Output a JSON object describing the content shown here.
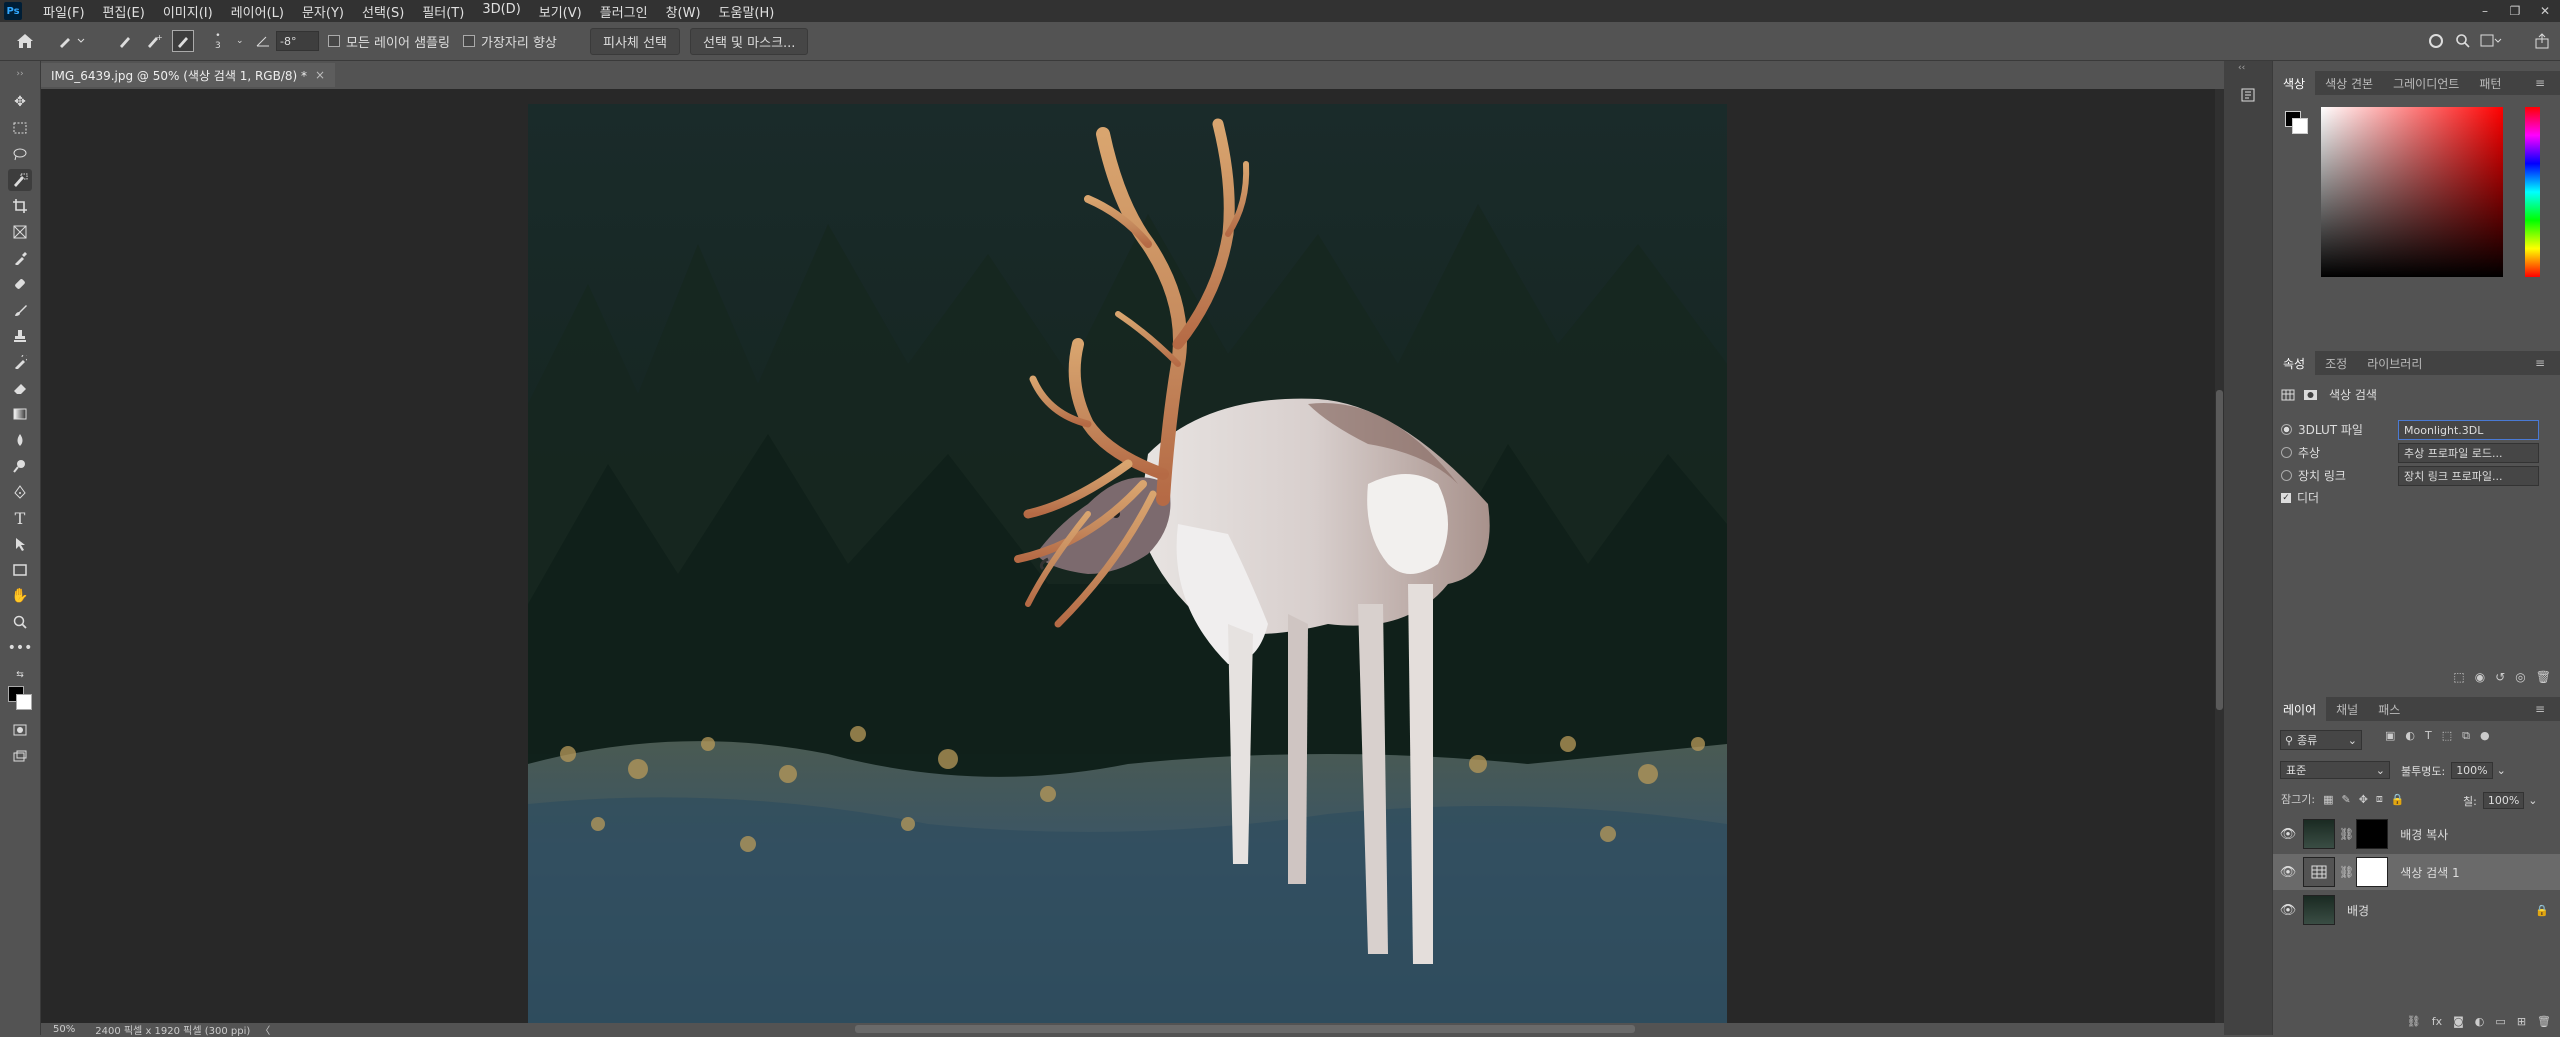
{
  "app": {
    "logo": "Ps"
  },
  "menu": [
    "파일(F)",
    "편집(E)",
    "이미지(I)",
    "레이어(L)",
    "문자(Y)",
    "선택(S)",
    "필터(T)",
    "3D(D)",
    "보기(V)",
    "플러그인",
    "창(W)",
    "도움말(H)"
  ],
  "window_controls": {
    "minimize": "–",
    "restore": "❐",
    "close": "✕"
  },
  "options": {
    "brush_size": "3",
    "angle": "-8°",
    "sample_all_layers": "모든 레이어 샘플링",
    "enhance_edge": "가장자리 향상",
    "select_subject": "피사체 선택",
    "select_and_mask": "선택 및 마스크..."
  },
  "document": {
    "tab_title": "IMG_6439.jpg @ 50% (색상 검색 1, RGB/8) *",
    "close_glyph": "×",
    "zoom": "50%",
    "size_info": "2400 픽셀 x 1920 픽셀 (300 ppi)",
    "status_arrow": "〈"
  },
  "color_panel": {
    "tabs": [
      "색상",
      "색상 견본",
      "그레이디언트",
      "패턴"
    ],
    "active_tab": 0,
    "hue": "#ff0000"
  },
  "properties_panel": {
    "tabs": [
      "속성",
      "조정",
      "라이브러리"
    ],
    "active_tab": 0,
    "title": "색상 검색",
    "rows": [
      {
        "label": "3DLUT 파일",
        "value": "Moonlight.3DL",
        "selected": true
      },
      {
        "label": "추상",
        "value": "추상 프로파일 로드...",
        "selected": false
      },
      {
        "label": "장치 링크",
        "value": "장치 링크 프로파일...",
        "selected": false
      }
    ],
    "dither_label": "디더"
  },
  "layers_panel": {
    "tabs": [
      "레이어",
      "채널",
      "패스"
    ],
    "active_tab": 0,
    "filter_kind": "종류",
    "blend_mode": "표준",
    "opacity_label": "불투명도:",
    "opacity": "100%",
    "lock_label": "잠그기:",
    "fill_label": "칠:",
    "fill": "100%",
    "layers": [
      {
        "name": "배경 복사",
        "selected": false
      },
      {
        "name": "색상 검색 1",
        "selected": true
      },
      {
        "name": "배경",
        "selected": false
      }
    ],
    "footer_icons": [
      "link-icon",
      "fx",
      "mask-icon",
      "adjustment-icon",
      "folder-icon",
      "new-layer-icon",
      "trash-icon"
    ]
  }
}
